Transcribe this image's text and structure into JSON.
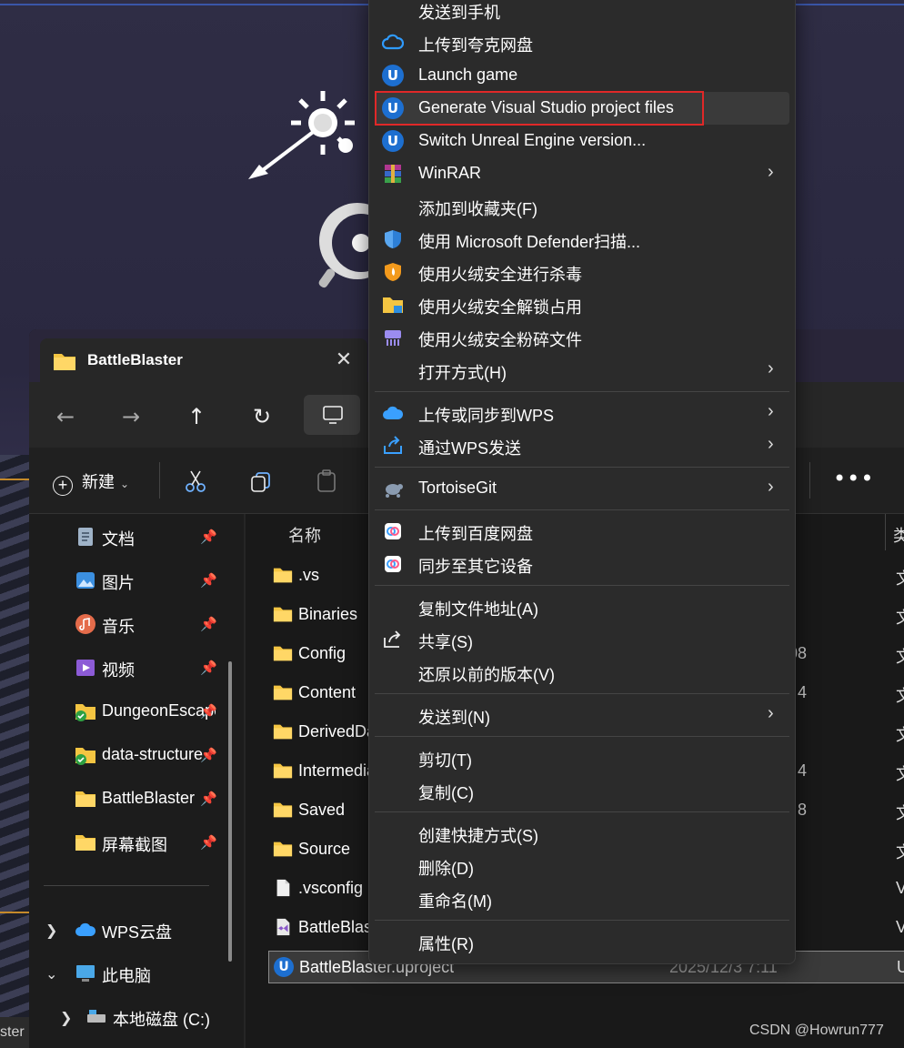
{
  "explorer": {
    "tab_title": "BattleBlaster",
    "toolbar": {
      "new_label": "新建"
    },
    "sidebar": {
      "items": [
        {
          "label": "文档",
          "icon": "document-icon"
        },
        {
          "label": "图片",
          "icon": "pictures-icon"
        },
        {
          "label": "音乐",
          "icon": "music-icon"
        },
        {
          "label": "视频",
          "icon": "video-icon"
        },
        {
          "label": "DungeonEscape",
          "icon": "folder-sync-icon"
        },
        {
          "label": "data-structure",
          "icon": "folder-sync-icon"
        },
        {
          "label": "BattleBlaster",
          "icon": "folder-icon"
        },
        {
          "label": "屏幕截图",
          "icon": "folder-icon"
        }
      ],
      "wps_cloud": "WPS云盘",
      "this_pc": "此电脑",
      "local_disk": "本地磁盘 (C:)"
    },
    "columns": {
      "name": "名称",
      "type_fragment": "类"
    },
    "files": [
      {
        "name": ".vs",
        "frag": "",
        "type": "文"
      },
      {
        "name": "Binaries",
        "frag": "",
        "type": "文"
      },
      {
        "name": "Config",
        "frag": "08",
        "type": "文"
      },
      {
        "name": "Content",
        "frag": "4",
        "type": "文"
      },
      {
        "name": "DerivedDataCache",
        "frag": "",
        "type": "文"
      },
      {
        "name": "Intermediate",
        "frag": "4",
        "type": "文"
      },
      {
        "name": "Saved",
        "frag": "8",
        "type": "文"
      },
      {
        "name": "Source",
        "frag": "",
        "type": "文"
      },
      {
        "name": ".vsconfig",
        "frag": "",
        "type": "V"
      },
      {
        "name": "BattleBlaster.sln",
        "frag": "",
        "type": "V"
      }
    ],
    "selected_file": {
      "name": "BattleBlaster.uproject",
      "date": "2025/12/3 7:11",
      "type": "U"
    }
  },
  "menu": {
    "items": [
      {
        "label": "发送到手机"
      },
      {
        "label": "上传到夸克网盘"
      },
      {
        "label": "Launch game"
      },
      {
        "label": "Generate Visual Studio project files"
      },
      {
        "label": "Switch Unreal Engine version..."
      },
      {
        "label": "WinRAR"
      },
      {
        "label": "添加到收藏夹(F)"
      },
      {
        "label": "使用 Microsoft Defender扫描..."
      },
      {
        "label": "使用火绒安全进行杀毒"
      },
      {
        "label": "使用火绒安全解锁占用"
      },
      {
        "label": "使用火绒安全粉碎文件"
      },
      {
        "label": "打开方式(H)"
      },
      {
        "label": "上传或同步到WPS"
      },
      {
        "label": "通过WPS发送"
      },
      {
        "label": "TortoiseGit"
      },
      {
        "label": "上传到百度网盘"
      },
      {
        "label": "同步至其它设备"
      },
      {
        "label": "复制文件地址(A)"
      },
      {
        "label": "共享(S)"
      },
      {
        "label": "还原以前的版本(V)"
      },
      {
        "label": "发送到(N)"
      },
      {
        "label": "剪切(T)"
      },
      {
        "label": "复制(C)"
      },
      {
        "label": "创建快捷方式(S)"
      },
      {
        "label": "删除(D)"
      },
      {
        "label": "重命名(M)"
      },
      {
        "label": "属性(R)"
      }
    ],
    "highlight_color": "#e02828"
  },
  "background": {
    "bottom_label": "ster"
  },
  "watermark": "CSDN @Howrun777"
}
